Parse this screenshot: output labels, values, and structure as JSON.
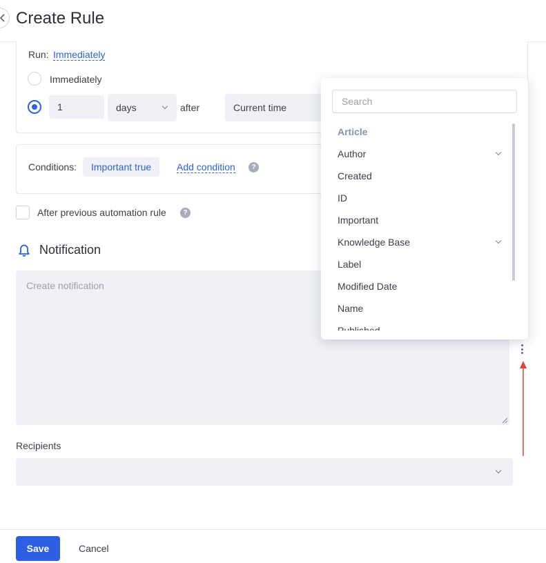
{
  "header": {
    "title": "Create Rule",
    "back_icon": "chevron-left-icon"
  },
  "run": {
    "label": "Run:",
    "value_link": "Immediately",
    "option_immediately": "Immediately",
    "delay_value": "1",
    "delay_unit": "days",
    "after_text": "after",
    "reference": "Current time"
  },
  "conditions": {
    "label": "Conditions:",
    "chip": "Important true",
    "add_link": "Add condition",
    "help_glyph": "?"
  },
  "after_previous": {
    "label": "After previous automation rule",
    "help_glyph": "?"
  },
  "notification": {
    "title": "Notification",
    "icon": "bell-icon",
    "placeholder": "Create notification"
  },
  "recipients": {
    "label": "Recipients",
    "value": ""
  },
  "footer": {
    "save": "Save",
    "cancel": "Cancel"
  },
  "dropdown": {
    "search_placeholder": "Search",
    "group": "Article",
    "items": [
      {
        "label": "Author",
        "expandable": true
      },
      {
        "label": "Created",
        "expandable": false
      },
      {
        "label": "ID",
        "expandable": false
      },
      {
        "label": "Important",
        "expandable": false
      },
      {
        "label": "Knowledge Base",
        "expandable": true
      },
      {
        "label": "Label",
        "expandable": false
      },
      {
        "label": "Modified Date",
        "expandable": false
      },
      {
        "label": "Name",
        "expandable": false
      },
      {
        "label": "Published",
        "expandable": false
      }
    ]
  },
  "colors": {
    "accent": "#2e5fe3",
    "link": "#2d63d8",
    "field_bg": "#f0f1f6",
    "arrow": "#e0413a"
  }
}
